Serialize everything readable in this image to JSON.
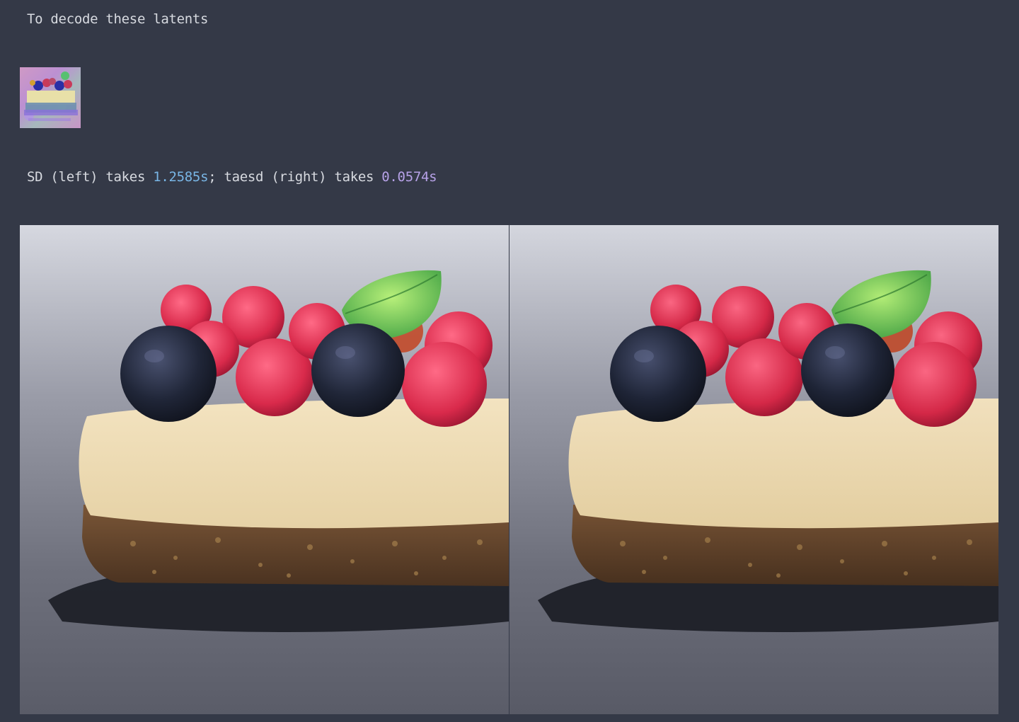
{
  "text": {
    "intro": "To decode these latents",
    "timing": {
      "prefix": "SD (left) takes ",
      "sd_time": "1.2585s",
      "middle": "; taesd (right) takes ",
      "taesd_time": "0.0574s"
    }
  },
  "colors": {
    "background": "#343947",
    "text": "#d7dae0",
    "number_blue": "#79b6e6",
    "number_purple": "#b7a2e8"
  },
  "images": {
    "latent_preview": "latent-thumbnail",
    "left": "sd-decoded-cheesecake",
    "right": "taesd-decoded-cheesecake"
  }
}
